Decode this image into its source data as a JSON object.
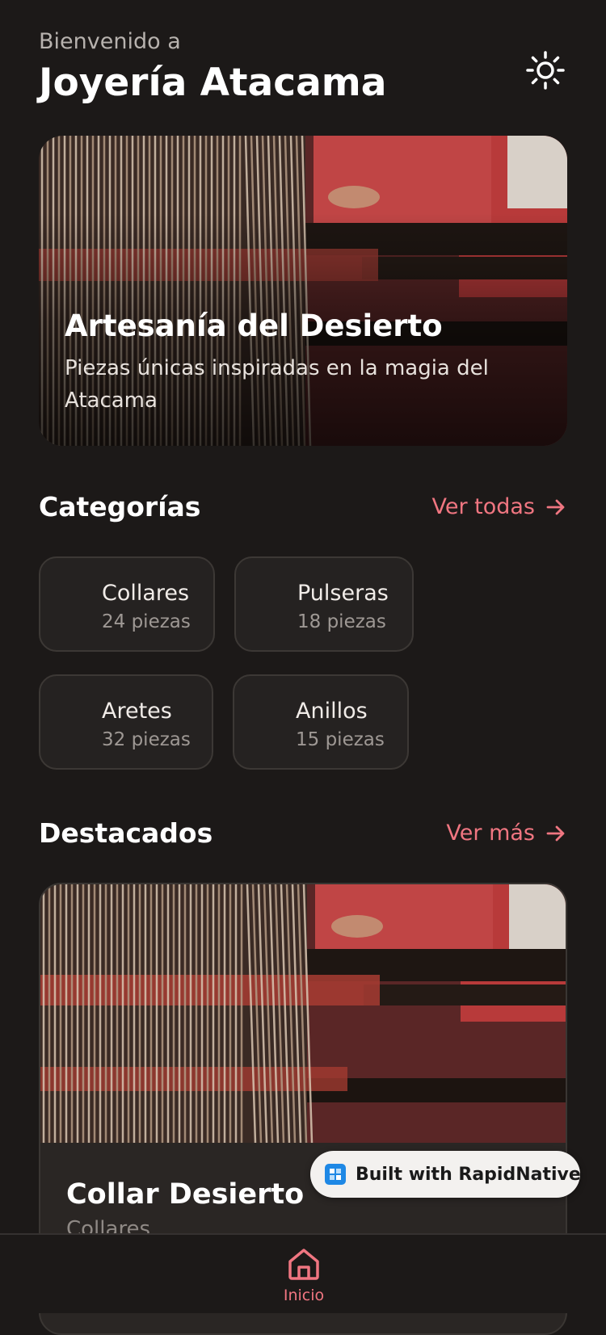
{
  "header": {
    "greeting": "Bienvenido a",
    "title": "Joyería Atacama",
    "theme_icon": "sun-icon"
  },
  "hero": {
    "title": "Artesanía del Desierto",
    "subtitle": "Piezas únicas inspiradas en la magia del Atacama"
  },
  "categories_section": {
    "title": "Categorías",
    "link": "Ver todas",
    "items": [
      {
        "name": "Collares",
        "count": "24 piezas"
      },
      {
        "name": "Pulseras",
        "count": "18 piezas"
      },
      {
        "name": "Aretes",
        "count": "32 piezas"
      },
      {
        "name": "Anillos",
        "count": "15 piezas"
      }
    ]
  },
  "featured_section": {
    "title": "Destacados",
    "link": "Ver más",
    "items": [
      {
        "title": "Collar Desierto",
        "category": "Collares"
      }
    ]
  },
  "badge": {
    "text": "Built with RapidNative"
  },
  "tabbar": {
    "items": [
      {
        "label": "Inicio",
        "icon": "home-icon",
        "active": true
      }
    ]
  },
  "colors": {
    "background": "#1c1918",
    "accent": "#f07681",
    "card": "#252221"
  }
}
